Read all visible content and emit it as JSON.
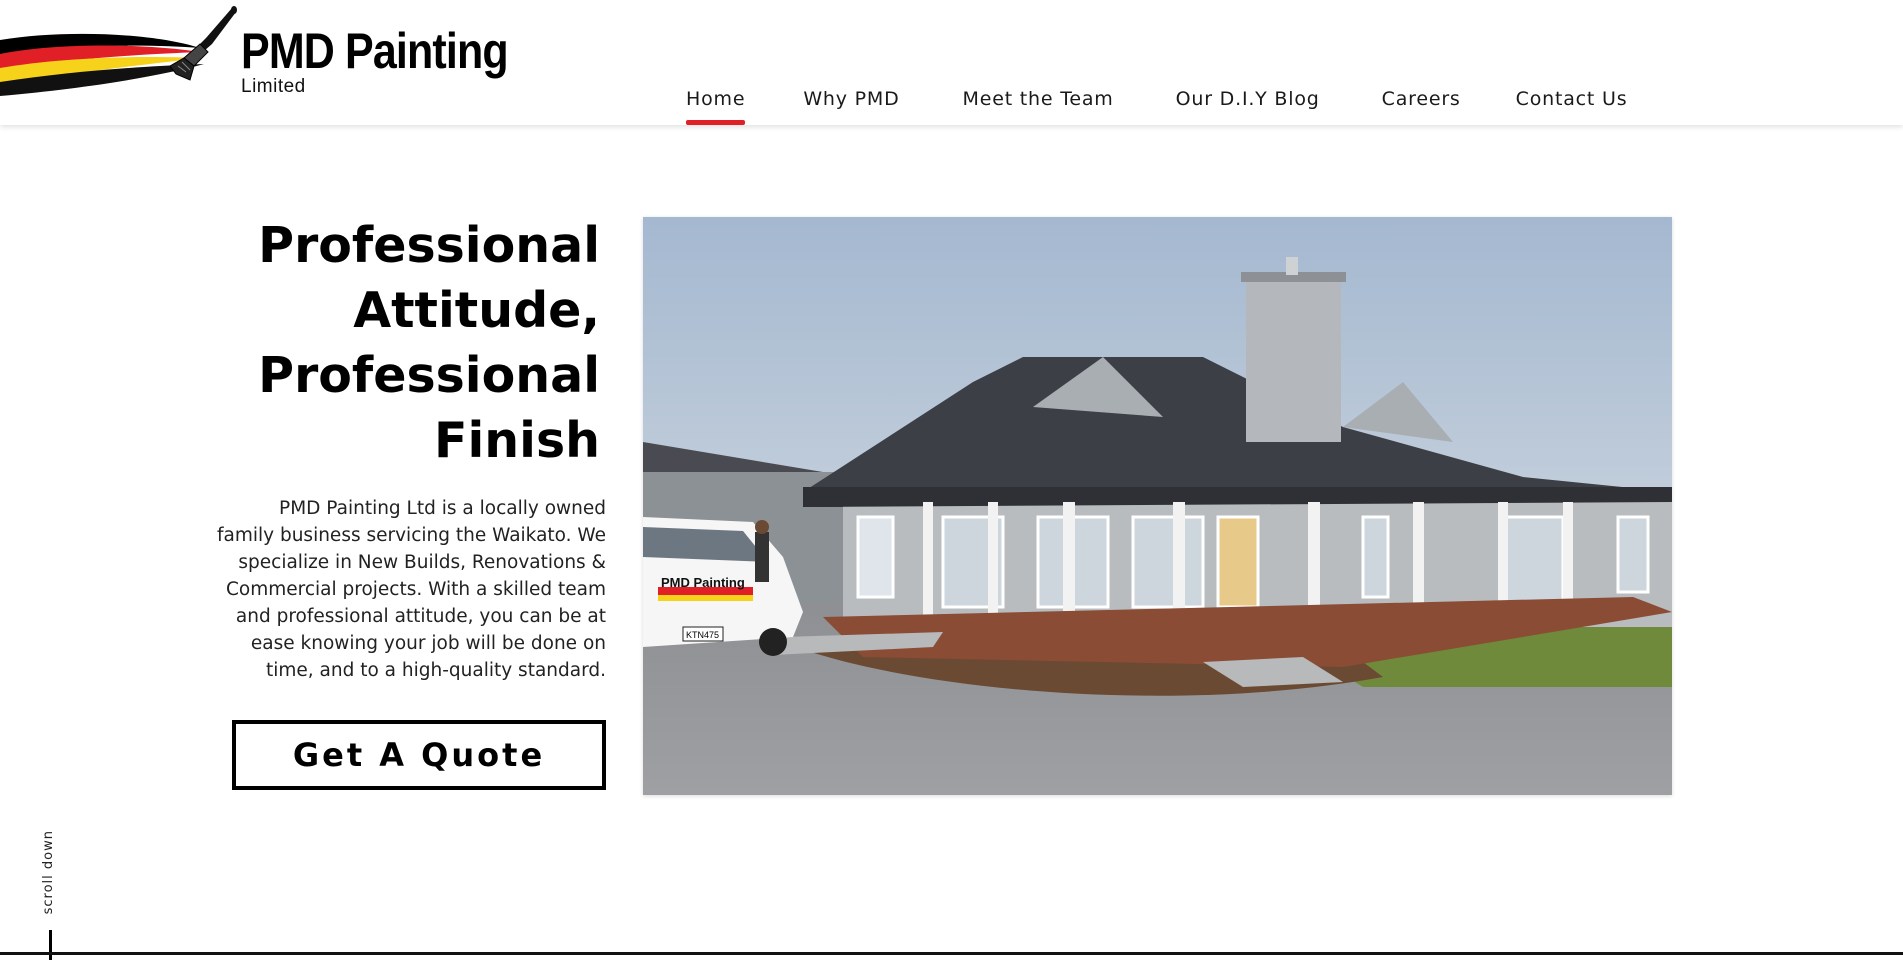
{
  "brand": {
    "title": "PMD Painting",
    "subtitle": "Limited",
    "colors": {
      "red": "#e01f26",
      "yellow": "#f6d21a",
      "black": "#000000"
    },
    "logo_icon": "paintbrush-swoosh-icon"
  },
  "nav": {
    "items": [
      {
        "label": "Home",
        "active": true
      },
      {
        "label": "Why PMD",
        "active": false
      },
      {
        "label": "Meet the Team",
        "active": false
      },
      {
        "label": "Our D.I.Y Blog",
        "active": false
      },
      {
        "label": "Careers",
        "active": false
      },
      {
        "label": "Contact Us",
        "active": false
      }
    ],
    "active_color": "#e01f26"
  },
  "hero": {
    "title_lines": [
      "Professional",
      "Attitude,",
      "Professional",
      "Finish"
    ],
    "description_lines": [
      "PMD Painting Ltd is a locally owned",
      "family business servicing the Waikato. We",
      "specialize in New Builds, Renovations &",
      "Commercial projects.  With a skilled team",
      "and professional attitude, you can be at",
      "ease knowing your job will be done on",
      "time, and to a high-quality standard."
    ],
    "cta_label": "Get A Quote",
    "van_text": "PMD Painting",
    "plate_text": "KTN475"
  },
  "scroll": {
    "label": "scroll down"
  }
}
